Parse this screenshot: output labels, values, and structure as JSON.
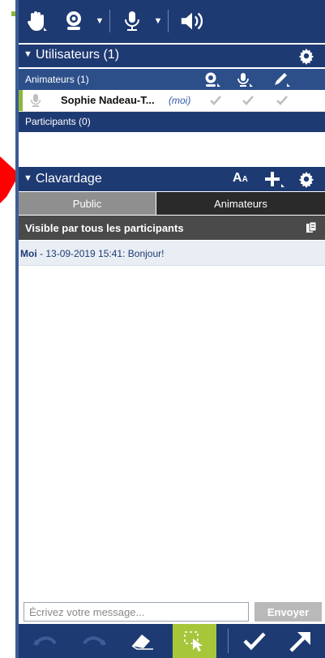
{
  "users_panel": {
    "title": "Utilisateurs (1)",
    "animators_label": "Animateurs (1)",
    "user": {
      "name": "Sophie Nadeau-T...",
      "tag": "(moi)"
    },
    "participants_label": "Participants (0)"
  },
  "chat_panel": {
    "title": "Clavardage",
    "font_button": "A",
    "font_button_small": "A",
    "tabs": [
      "Public",
      "Animateurs"
    ],
    "visibility_text": "Visible par tous les participants",
    "messages": [
      {
        "author": "Moi",
        "separator": " - ",
        "timestamp": "13-09-2019 15:41:",
        "text": " Bonjour!"
      }
    ],
    "input_placeholder": "Écrivez votre message...",
    "send_label": "Envoyer"
  },
  "colors": {
    "navy": "#1e3a72",
    "accent_green": "#a7c63a",
    "tab_active": "#8f8f8f"
  },
  "icons": {
    "top_toolbar": [
      "hand-icon",
      "webcam-icon",
      "microphone-icon",
      "speaker-icon"
    ],
    "bottom_toolbar": [
      "undo-icon",
      "redo-icon",
      "eraser-icon",
      "select-icon",
      "check-icon",
      "arrow-icon"
    ]
  }
}
